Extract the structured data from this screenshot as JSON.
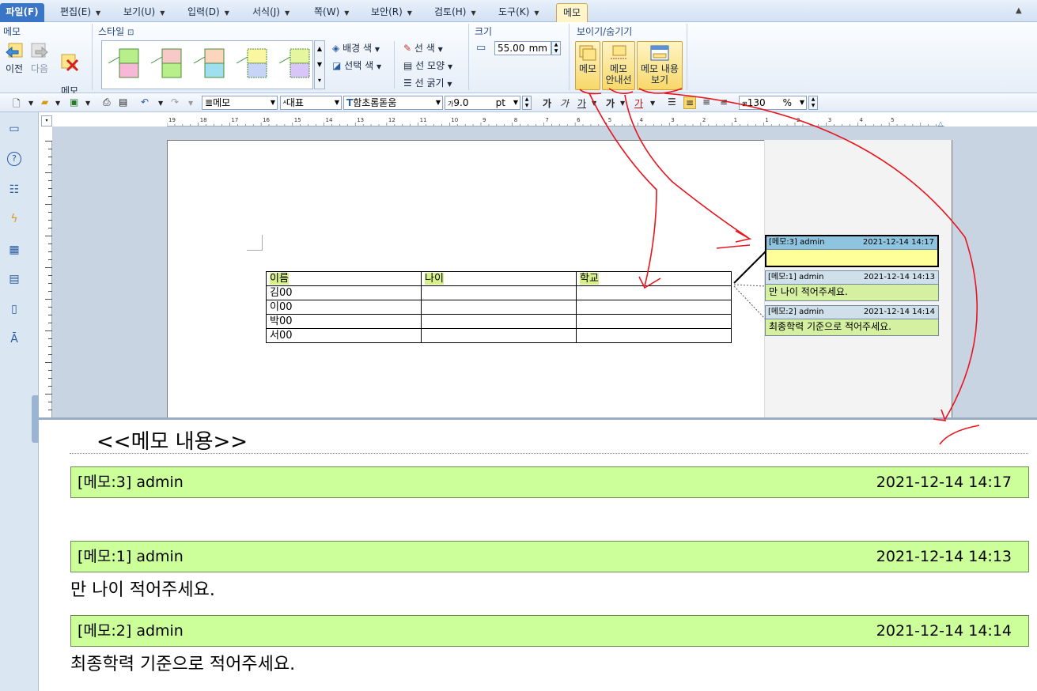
{
  "menubar": {
    "file": "파일(F)",
    "edit": "편집(E)",
    "view": "보기(U)",
    "input": "입력(D)",
    "format": "서식(J)",
    "page": "쪽(W)",
    "security": "보안(R)",
    "review": "검토(H)",
    "tools": "도구(K)",
    "memo": "메모"
  },
  "ribbon": {
    "memo_group": "메모",
    "prev": "이전",
    "next": "다음",
    "delete_memo": "메모\n지우기",
    "style_group": "스타일",
    "bg_color": "배경 색",
    "sel_color": "선택 색",
    "line_color": "선 색",
    "line_shape": "선 모양",
    "line_width": "선 굵기",
    "size_group": "크기",
    "size_value": "55.00",
    "size_unit": "mm",
    "show_group": "보이기/숨기기",
    "btn_memo": "메모",
    "btn_guide_1": "메모",
    "btn_guide_2": "안내선",
    "btn_content_1": "메모 내용",
    "btn_content_2": "보기"
  },
  "toolbar": {
    "style": "메모",
    "lang": "대표",
    "font": "함초롬돋움",
    "font_size": "9.0",
    "font_unit": "pt",
    "bold": "가",
    "italic": "가",
    "underline": "가",
    "strike": "가",
    "fontcolor": "가",
    "zoom": "130",
    "zoom_unit": "%"
  },
  "ruler": {
    "ticks": [
      "19",
      "18",
      "17",
      "16",
      "15",
      "14",
      "13",
      "12",
      "11",
      "10",
      "9",
      "8",
      "7",
      "6",
      "5",
      "4",
      "3",
      "2",
      "1",
      "1",
      "2",
      "3",
      "4",
      "5"
    ]
  },
  "table": {
    "headers": [
      "이름",
      "나이",
      "학교"
    ],
    "rows": [
      [
        "김00",
        "",
        ""
      ],
      [
        "이00",
        "",
        ""
      ],
      [
        "박00",
        "",
        ""
      ],
      [
        "서00",
        "",
        ""
      ]
    ]
  },
  "memos": [
    {
      "id": "[메모:3] admin",
      "date": "2021-12-14 14:17",
      "text": ""
    },
    {
      "id": "[메모:1] admin",
      "date": "2021-12-14 14:13",
      "text": "만 나이 적어주세요."
    },
    {
      "id": "[메모:2] admin",
      "date": "2021-12-14 14:14",
      "text": "최종학력 기준으로 적어주세요."
    }
  ],
  "panel": {
    "title": "<<메모 내용>>"
  },
  "colors": {
    "memo_bg": "#ccff99",
    "accent": "#3a76c5",
    "annotation": "#e8141e"
  }
}
